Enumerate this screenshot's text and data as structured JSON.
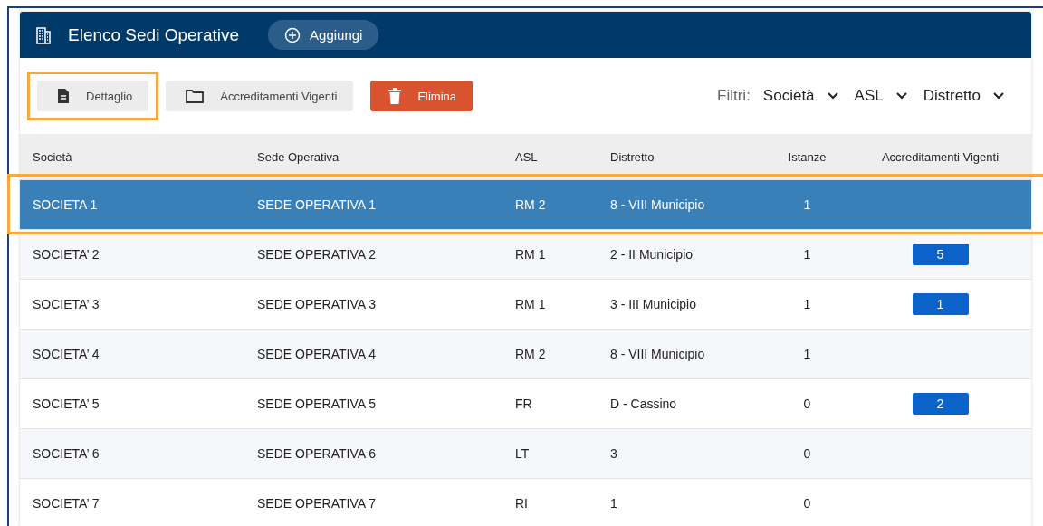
{
  "header": {
    "title": "Elenco Sedi Operative",
    "add_button": "Aggiungi"
  },
  "toolbar": {
    "buttons": [
      {
        "label": "Dettaglio",
        "kind": "detail",
        "highlighted": true
      },
      {
        "label": "Accreditamenti Vigenti",
        "kind": "folder",
        "highlighted": false
      },
      {
        "label": "Elimina",
        "kind": "delete",
        "highlighted": false
      }
    ],
    "filters_label": "Filtri:",
    "filters": [
      "Società",
      "ASL",
      "Distretto"
    ]
  },
  "table": {
    "columns": [
      "Società",
      "Sede Operativa",
      "ASL",
      "Distretto",
      "Istanze",
      "Accreditamenti Vigenti"
    ],
    "rows": [
      {
        "cells": [
          "SOCIETA 1",
          "SEDE OPERATIVA 1",
          "RM 2",
          "8 - VIII Municipio",
          "1"
        ],
        "badge": null,
        "selected": true,
        "highlighted": true
      },
      {
        "cells": [
          "SOCIETA’ 2",
          "SEDE OPERATIVA 2",
          "RM 1",
          "2 - II Municipio",
          "1"
        ],
        "badge": "5",
        "selected": false,
        "highlighted": false
      },
      {
        "cells": [
          "SOCIETA’ 3",
          "SEDE OPERATIVA 3",
          "RM 1",
          "3 - III Municipio",
          "1"
        ],
        "badge": "1",
        "selected": false,
        "highlighted": false
      },
      {
        "cells": [
          "SOCIETA’ 4",
          "SEDE OPERATIVA 4",
          "RM 2",
          "8 - VIII Municipio",
          "1"
        ],
        "badge": null,
        "selected": false,
        "highlighted": false
      },
      {
        "cells": [
          "SOCIETA’ 5",
          "SEDE OPERATIVA 5",
          "FR",
          "D - Cassino",
          "0"
        ],
        "badge": "2",
        "selected": false,
        "highlighted": false
      },
      {
        "cells": [
          "SOCIETA’ 6",
          "SEDE OPERATIVA 6",
          "LT",
          "3",
          "0"
        ],
        "badge": null,
        "selected": false,
        "highlighted": false
      },
      {
        "cells": [
          "SOCIETA’ 7",
          "SEDE OPERATIVA 7",
          "RI",
          "1",
          "0"
        ],
        "badge": null,
        "selected": false,
        "highlighted": false
      }
    ]
  }
}
